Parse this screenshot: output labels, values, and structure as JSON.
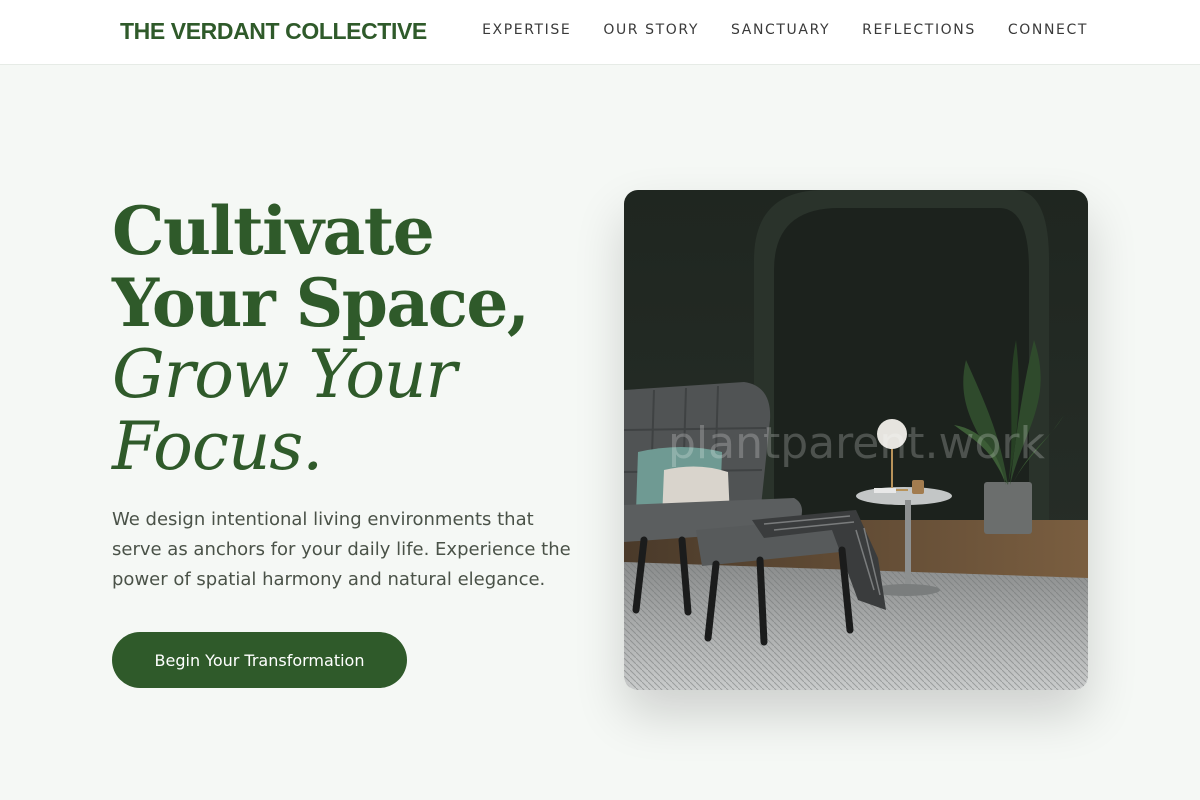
{
  "header": {
    "brand": "THE VERDANT COLLECTIVE",
    "nav": [
      "EXPERTISE",
      "OUR STORY",
      "SANCTUARY",
      "REFLECTIONS",
      "CONNECT"
    ]
  },
  "hero": {
    "title_line1": "Cultivate",
    "title_line2": "Your Space,",
    "title_line3": "Grow Your",
    "title_line4": "Focus.",
    "description": "We design intentional living environments that serve as anchors for your daily life. Experience the power of spatial harmony and natural elegance.",
    "cta_label": "Begin Your Transformation"
  },
  "image": {
    "watermark": "plantparent.work"
  },
  "colors": {
    "accent": "#2f5a2a",
    "background": "#f5f8f5",
    "body_text": "#4a5248"
  }
}
